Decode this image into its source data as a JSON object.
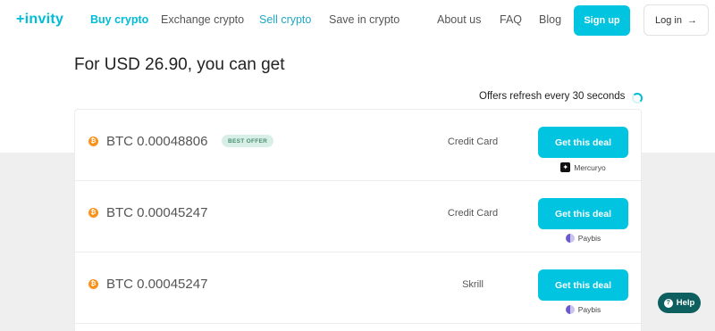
{
  "header": {
    "logo": "+invity",
    "nav": [
      "Buy crypto",
      "Exchange crypto",
      "Sell crypto",
      "Save in crypto",
      "About us",
      "FAQ",
      "Blog"
    ],
    "signup_label": "Sign up",
    "login_label": "Log in",
    "login_icon": "arrow-right-icon"
  },
  "main": {
    "title": "For USD 26.90, you can get",
    "refresh_text": "Offers refresh every 30 seconds",
    "offers": [
      {
        "coin_icon": "bitcoin-icon",
        "amount": "BTC 0.00048806",
        "badge": "BEST OFFER",
        "method": "Credit Card",
        "button": "Get this deal",
        "provider": "Mercuryo"
      },
      {
        "coin_icon": "bitcoin-icon",
        "amount": "BTC 0.00045247",
        "method": "Credit Card",
        "button": "Get this deal",
        "provider": "Paybis"
      },
      {
        "coin_icon": "bitcoin-icon",
        "amount": "BTC 0.00045247",
        "method": "Skrill",
        "button": "Get this deal",
        "provider": "Paybis"
      }
    ]
  },
  "help": {
    "label": "Help",
    "icon": "question-icon"
  },
  "colors": {
    "accent": "#00c4e0",
    "badge_bg": "#d7efe6",
    "help_bg": "#0e5f60"
  }
}
